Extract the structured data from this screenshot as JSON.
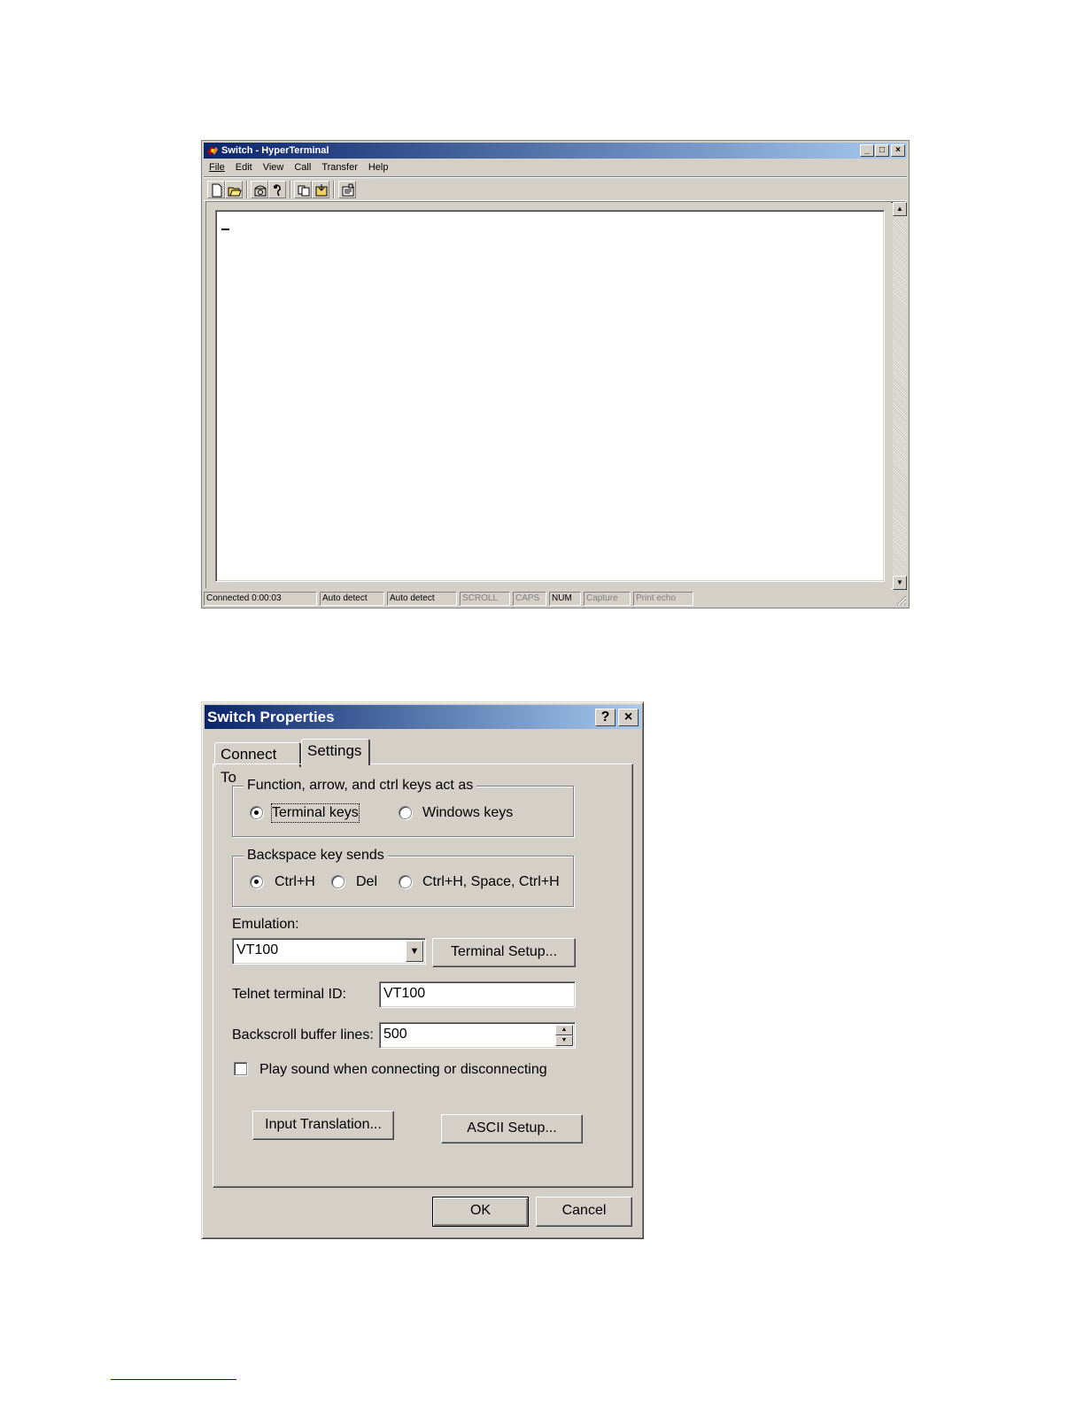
{
  "terminal_window": {
    "title": "Switch - HyperTerminal",
    "menu": [
      "File",
      "Edit",
      "View",
      "Call",
      "Transfer",
      "Help"
    ],
    "toolbar_icons": [
      "new-icon",
      "open-icon",
      "call-icon",
      "disconnect-icon",
      "send-icon",
      "receive-icon",
      "properties-icon"
    ],
    "caption_buttons": {
      "minimize": "_",
      "maximize": "□",
      "close": "×"
    },
    "cursor": "_",
    "status": {
      "connected": "Connected 0:00:03",
      "detect1": "Auto detect",
      "detect2": "Auto detect",
      "scroll": "SCROLL",
      "caps": "CAPS",
      "num": "NUM",
      "capture": "Capture",
      "print_echo": "Print echo"
    }
  },
  "dialog": {
    "title": "Switch Properties",
    "help_button": "?",
    "close_button": "×",
    "tabs": [
      "Connect To",
      "Settings"
    ],
    "active_tab": "Settings",
    "keys_group": {
      "legend": "Function, arrow, and ctrl keys act as",
      "option1": "Terminal keys",
      "option2": "Windows keys",
      "selected": "Terminal keys"
    },
    "backspace_group": {
      "legend": "Backspace key sends",
      "option1": "Ctrl+H",
      "option2": "Del",
      "option3": "Ctrl+H, Space, Ctrl+H",
      "selected": "Ctrl+H"
    },
    "emulation_label": "Emulation:",
    "emulation_value": "VT100",
    "terminal_setup": "Terminal Setup...",
    "telnet_label": "Telnet terminal ID:",
    "telnet_value": "VT100",
    "backscroll_label": "Backscroll buffer lines:",
    "backscroll_value": "500",
    "play_sound_label": "Play sound when connecting or disconnecting",
    "play_sound_checked": false,
    "input_translation": "Input Translation...",
    "ascii_setup": "ASCII Setup...",
    "ok": "OK",
    "cancel": "Cancel"
  },
  "colors": {
    "titlebar_start": "#0a246a",
    "titlebar_end": "#a6caf0",
    "face": "#d4d0c8"
  }
}
